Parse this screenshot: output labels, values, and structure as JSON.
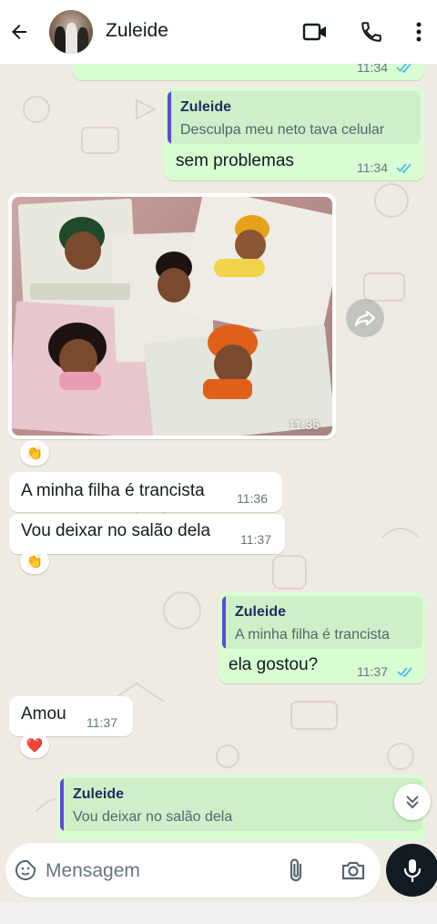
{
  "header": {
    "contact_name": "Zuleide"
  },
  "messages": [
    {
      "time": "11:34"
    },
    {
      "quote_name": "Zuleide",
      "quote_text": "Desculpa meu neto tava celular",
      "text": "sem problemas",
      "time": "11:34"
    },
    {
      "image_time": "11:35",
      "reaction": "👏"
    },
    {
      "text": "A minha filha é trancista",
      "time": "11:36"
    },
    {
      "text": "Vou deixar no salão dela",
      "time": "11:37",
      "reaction": "👏"
    },
    {
      "quote_name": "Zuleide",
      "quote_text": "A minha filha é trancista",
      "text": "ela gostou?",
      "time": "11:37"
    },
    {
      "text": "Amou",
      "time": "11:37",
      "reaction": "❤️"
    },
    {
      "quote_name": "Zuleide",
      "quote_text": "Vou deixar no salão dela"
    }
  ],
  "composer": {
    "placeholder": "Mensagem"
  },
  "colors": {
    "outgoing": "#d9fdd3",
    "incoming": "#ffffff",
    "read_ticks": "#53bdeb",
    "quote_bar": "#5b4bd6"
  },
  "icons": [
    "back-arrow-icon",
    "video-call-icon",
    "phone-icon",
    "more-vert-icon",
    "forward-icon",
    "chevron-double-down-icon",
    "sticker-icon",
    "attach-icon",
    "camera-icon",
    "mic-icon"
  ]
}
